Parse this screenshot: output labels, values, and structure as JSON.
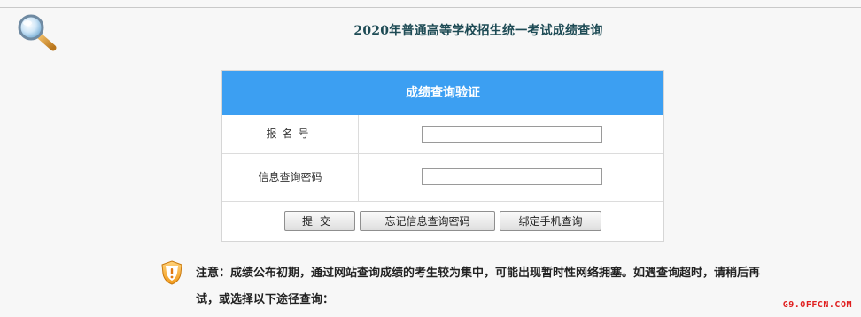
{
  "header": {
    "title": "2020年普通高等学校招生统一考试成绩查询",
    "icon": "magnifier-icon"
  },
  "panel": {
    "title": "成绩查询验证",
    "fields": [
      {
        "label": "报名号",
        "value": "",
        "placeholder": ""
      },
      {
        "label": "信息查询密码",
        "value": "",
        "placeholder": ""
      }
    ],
    "buttons": {
      "submit": "提交",
      "forgot": "忘记信息查询密码",
      "phone": "绑定手机查询"
    }
  },
  "notice": {
    "icon": "warning-shield-icon",
    "text": "注意：成绩公布初期，通过网站查询成绩的考生较为集中，可能出现暂时性网络拥塞。如遇查询超时，请稍后再试，或选择以下途径查询："
  },
  "watermark": "G9.OFFCN.COM",
  "colors": {
    "header_bg": "#3c9ff2",
    "title_text": "#1e4b55",
    "watermark": "#e02020"
  }
}
